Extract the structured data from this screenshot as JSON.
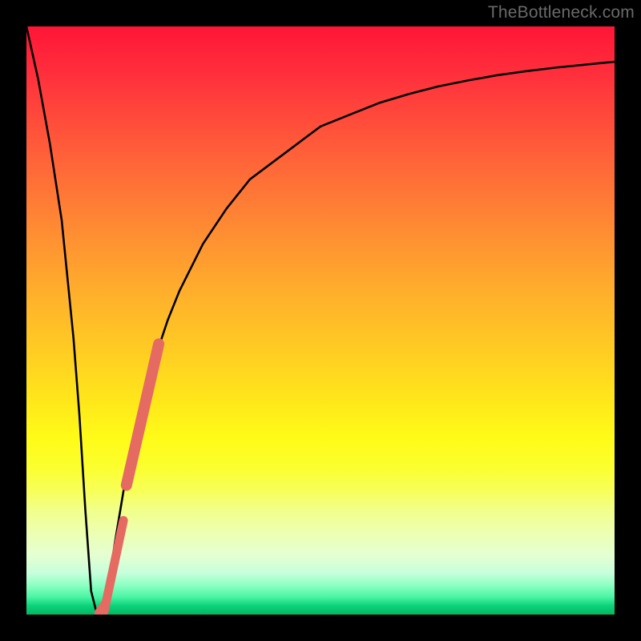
{
  "watermark": "TheBottleneck.com",
  "chart_data": {
    "type": "line",
    "title": "",
    "xlabel": "",
    "ylabel": "",
    "xlim": [
      0,
      100
    ],
    "ylim": [
      0,
      100
    ],
    "grid": false,
    "legend": false,
    "series": [
      {
        "name": "bottleneck-curve",
        "x": [
          0,
          2,
          4,
          6,
          8,
          9,
          10,
          11,
          12,
          13,
          14,
          15,
          16,
          17,
          18,
          19,
          20,
          22,
          24,
          26,
          28,
          30,
          34,
          38,
          42,
          46,
          50,
          55,
          60,
          65,
          70,
          75,
          80,
          85,
          90,
          95,
          100
        ],
        "y": [
          100,
          91,
          80,
          67,
          47,
          34,
          18,
          4,
          0,
          1,
          5,
          12,
          18,
          24,
          29,
          33,
          37,
          44,
          50,
          55,
          59,
          63,
          69,
          74,
          77,
          80,
          83,
          85,
          87,
          88.5,
          89.8,
          90.8,
          91.7,
          92.4,
          93,
          93.5,
          94
        ],
        "stroke": "#000000",
        "stroke_width": 2.6
      },
      {
        "name": "highlight-upper",
        "x": [
          17.0,
          22.5
        ],
        "y": [
          22.0,
          46.0
        ],
        "stroke": "#e46a62",
        "stroke_width": 14,
        "linecap": "round"
      },
      {
        "name": "highlight-lower",
        "x": [
          13.2,
          16.5
        ],
        "y": [
          0.5,
          16.0
        ],
        "stroke": "#e46a62",
        "stroke_width": 11,
        "linecap": "round"
      },
      {
        "name": "highlight-nub",
        "x": [
          12.3,
          13.5
        ],
        "y": [
          0.3,
          2.0
        ],
        "stroke": "#e46a62",
        "stroke_width": 11,
        "linecap": "round"
      }
    ]
  }
}
